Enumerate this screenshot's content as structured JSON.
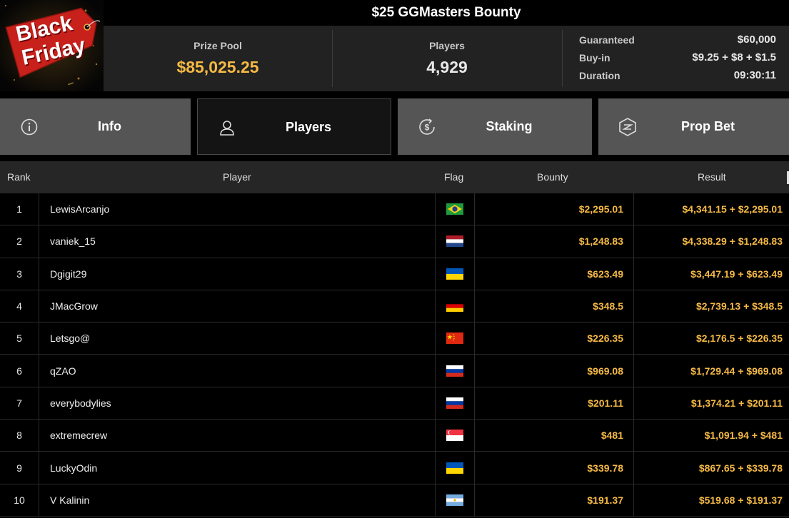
{
  "promo": {
    "line1": "Black",
    "line2": "Friday"
  },
  "tournament": {
    "title": "$25 GGMasters Bounty"
  },
  "stats": {
    "prize_pool_label": "Prize Pool",
    "prize_pool_value": "$85,025.25",
    "players_label": "Players",
    "players_value": "4,929",
    "details": [
      {
        "key": "Guaranteed",
        "value": "$60,000"
      },
      {
        "key": "Buy-in",
        "value": "$9.25 + $8 + $1.5"
      },
      {
        "key": "Duration",
        "value": "09:30:11"
      }
    ]
  },
  "tabs": [
    {
      "label": "Info",
      "icon": "info-icon",
      "active": false
    },
    {
      "label": "Players",
      "icon": "user-icon",
      "active": true
    },
    {
      "label": "Staking",
      "icon": "staking-icon",
      "active": false
    },
    {
      "label": "Prop Bet",
      "icon": "prop-bet-icon",
      "active": false
    }
  ],
  "table": {
    "columns": {
      "rank": "Rank",
      "player": "Player",
      "flag": "Flag",
      "bounty": "Bounty",
      "result": "Result"
    },
    "rows": [
      {
        "rank": "1",
        "player": "LewisArcanjo",
        "flag": "brazil",
        "bounty": "$2,295.01",
        "result": "$4,341.15 + $2,295.01"
      },
      {
        "rank": "2",
        "player": "vaniek_15",
        "flag": "netherlands",
        "bounty": "$1,248.83",
        "result": "$4,338.29 + $1,248.83"
      },
      {
        "rank": "3",
        "player": "Dgigit29",
        "flag": "ukraine",
        "bounty": "$623.49",
        "result": "$3,447.19 + $623.49"
      },
      {
        "rank": "4",
        "player": "JMacGrow",
        "flag": "germany",
        "bounty": "$348.5",
        "result": "$2,739.13 + $348.5"
      },
      {
        "rank": "5",
        "player": "Letsgo@",
        "flag": "china",
        "bounty": "$226.35",
        "result": "$2,176.5 + $226.35"
      },
      {
        "rank": "6",
        "player": "qZAO",
        "flag": "russia",
        "bounty": "$969.08",
        "result": "$1,729.44 + $969.08"
      },
      {
        "rank": "7",
        "player": "everybodylies",
        "flag": "russia",
        "bounty": "$201.11",
        "result": "$1,374.21 + $201.11"
      },
      {
        "rank": "8",
        "player": "extremecrew",
        "flag": "singapore",
        "bounty": "$481",
        "result": "$1,091.94 + $481"
      },
      {
        "rank": "9",
        "player": "LuckyOdin",
        "flag": "ukraine",
        "bounty": "$339.78",
        "result": "$867.65 + $339.78"
      },
      {
        "rank": "10",
        "player": "V Kalinin",
        "flag": "argentina",
        "bounty": "$191.37",
        "result": "$519.68 + $191.37"
      }
    ]
  },
  "colors": {
    "accent": "#f5b945",
    "promo_tag": "#c8211b",
    "stats_bg": "#222222",
    "tab_bg": "#555555"
  }
}
